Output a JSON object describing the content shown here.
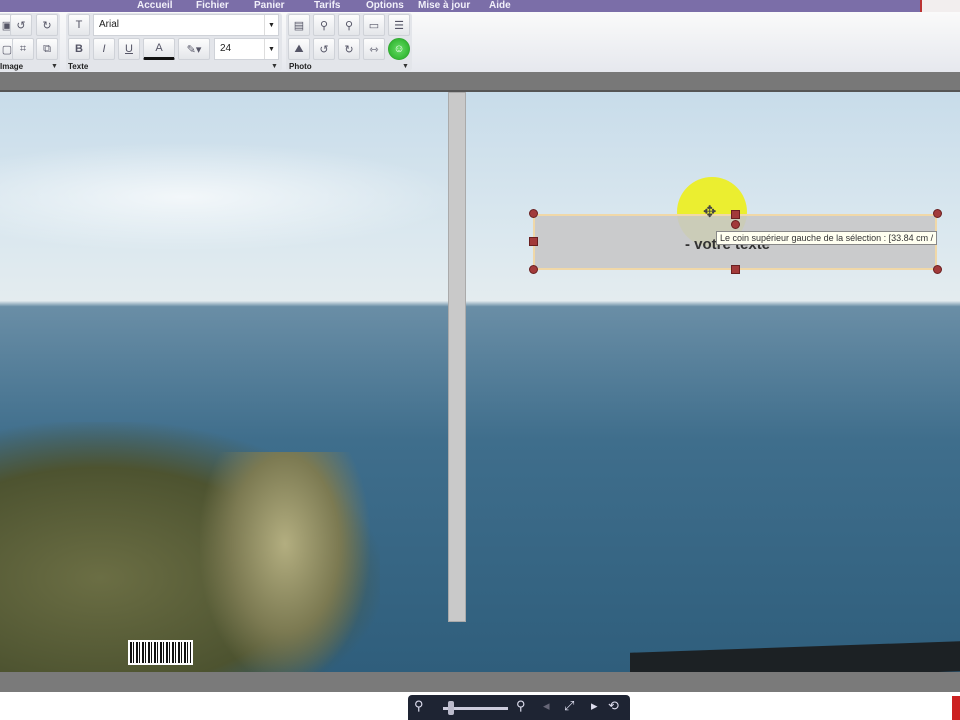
{
  "menu": [
    "Accueil",
    "Fichier",
    "Panier",
    "Tarifs",
    "Options",
    "Mise à jour",
    "Aide"
  ],
  "ribbon": {
    "image_label": "Image",
    "text_label": "Texte",
    "photo_label": "Photo",
    "font": "Arial",
    "font_size": "24",
    "bold": "B",
    "italic": "I",
    "underline": "U",
    "color": "A"
  },
  "canvas": {
    "textbox_text": "- votre texte",
    "tooltip": "Le coin supérieur gauche de la sélection : [33.84 cm /"
  }
}
